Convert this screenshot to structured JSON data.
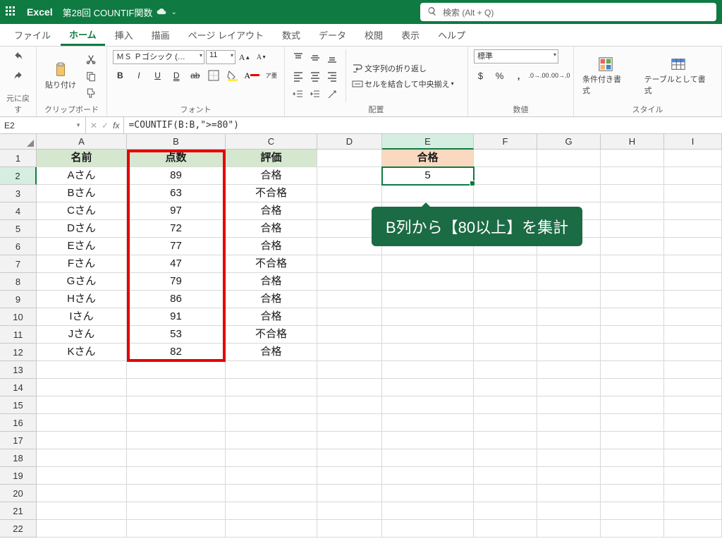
{
  "titlebar": {
    "app": "Excel",
    "doc": "第28回 COUNTIF関数",
    "search_placeholder": "検索 (Alt + Q)"
  },
  "tabs": {
    "file": "ファイル",
    "home": "ホーム",
    "insert": "挿入",
    "draw": "描画",
    "layout": "ページ レイアウト",
    "formulas": "数式",
    "data": "データ",
    "review": "校閲",
    "view": "表示",
    "help": "ヘルプ"
  },
  "ribbon": {
    "undo": "元に戻す",
    "clipboard": "クリップボード",
    "paste": "貼り付け",
    "font_label": "フォント",
    "font_name": "ＭＳ Ｐゴシック (…",
    "font_size": "11",
    "align_label": "配置",
    "wrap": "文字列の折り返し",
    "merge": "セルを結合して中央揃え",
    "number_label": "数値",
    "number_format": "標準",
    "style_label": "スタイル",
    "cond": "条件付き書式",
    "tablestyle": "テーブルとして書式"
  },
  "fxbar": {
    "namebox": "E2",
    "formula": "=COUNTIF(B:B,\">=80\")"
  },
  "columns": [
    "A",
    "B",
    "C",
    "D",
    "E",
    "F",
    "G",
    "H",
    "I"
  ],
  "heads": {
    "A": "名前",
    "B": "点数",
    "C": "評価",
    "E": "合格"
  },
  "e2": "5",
  "rows": [
    {
      "a": "Aさん",
      "b": "89",
      "c": "合格"
    },
    {
      "a": "Bさん",
      "b": "63",
      "c": "不合格"
    },
    {
      "a": "Cさん",
      "b": "97",
      "c": "合格"
    },
    {
      "a": "Dさん",
      "b": "72",
      "c": "合格"
    },
    {
      "a": "Eさん",
      "b": "77",
      "c": "合格"
    },
    {
      "a": "Fさん",
      "b": "47",
      "c": "不合格"
    },
    {
      "a": "Gさん",
      "b": "79",
      "c": "合格"
    },
    {
      "a": "Hさん",
      "b": "86",
      "c": "合格"
    },
    {
      "a": "Iさん",
      "b": "91",
      "c": "合格"
    },
    {
      "a": "Jさん",
      "b": "53",
      "c": "不合格"
    },
    {
      "a": "Kさん",
      "b": "82",
      "c": "合格"
    }
  ],
  "callout": "B列から【80以上】を集計"
}
